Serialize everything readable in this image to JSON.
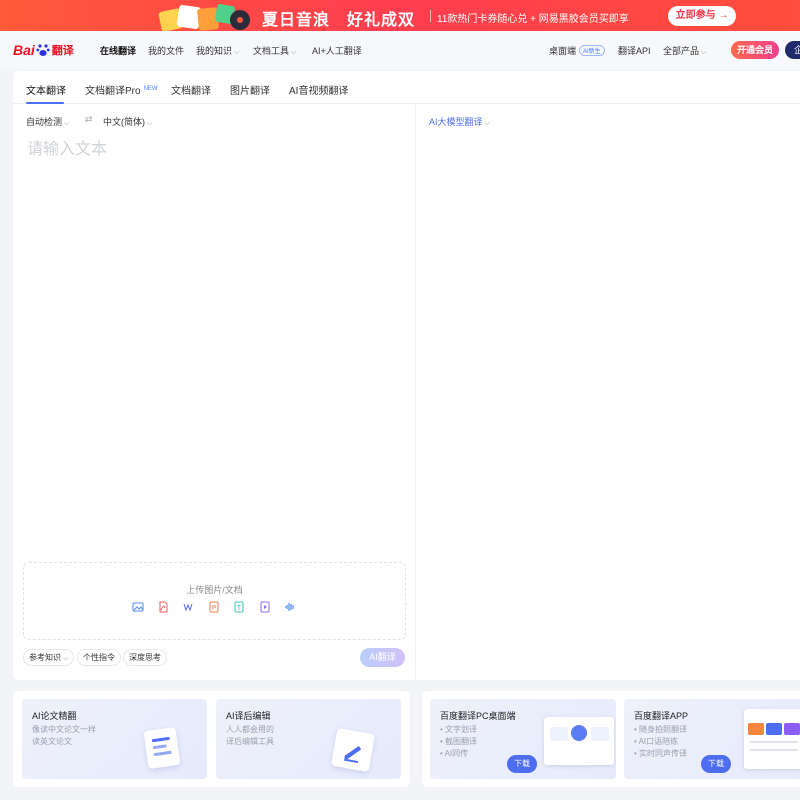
{
  "banner": {
    "title": "夏日音浪　好礼成双",
    "subtitle": "11款热门卡券随心兑 + 网易黑胶会员买即享",
    "cta": "立即参与 →"
  },
  "nav": {
    "logo_text": "Bai",
    "logo_suffix": "翻译",
    "items": [
      {
        "label": "在线翻译"
      },
      {
        "label": "我的文件"
      },
      {
        "label": "我的知识"
      },
      {
        "label": "文档工具"
      },
      {
        "label": "AI+人工翻译"
      }
    ],
    "right": {
      "desktop": "桌面端",
      "desktop_badge": "AI新生",
      "api": "翻译API",
      "products": "全部产品",
      "vip": "开通会员",
      "enterprise": "企"
    }
  },
  "tabs": [
    {
      "label": "文本翻译"
    },
    {
      "label": "文档翻译Pro",
      "badge": "NEW"
    },
    {
      "label": "文档翻译"
    },
    {
      "label": "图片翻译"
    },
    {
      "label": "AI音视频翻译"
    }
  ],
  "translator": {
    "source_lang": "自动检测",
    "target_lang": "中文(简体)",
    "model": "AI大模型翻译",
    "placeholder": "请输入文本",
    "upload_label": "上传图片/文档",
    "file_icons": [
      "image-file-icon",
      "pdf-file-icon",
      "word-file-icon",
      "ppt-file-icon",
      "txt-file-icon",
      "video-file-icon",
      "audio-file-icon"
    ],
    "options": [
      "参考知识",
      "个性指令",
      "深度思考"
    ],
    "translate_button": "AI翻译"
  },
  "features": {
    "left": [
      {
        "title": "AI论文精翻",
        "lines": [
          "像读中文论文一样",
          "读英文论文"
        ]
      },
      {
        "title": "AI译后编辑",
        "lines": [
          "人人都会用的",
          "译后编辑工具"
        ]
      }
    ],
    "right": [
      {
        "title": "百度翻译PC桌面端",
        "lines": [
          "• 文字划译",
          "• 截图翻译",
          "• AI同传"
        ],
        "button": "下载"
      },
      {
        "title": "百度翻译APP",
        "lines": [
          "• 随身拍照翻译",
          "• AI口语陪练",
          "• 实时同声传译"
        ],
        "button": "下载"
      }
    ]
  },
  "colors": {
    "banner": "#ff4046",
    "accent": "#4e6ef2",
    "brand_red": "#ee1122"
  }
}
